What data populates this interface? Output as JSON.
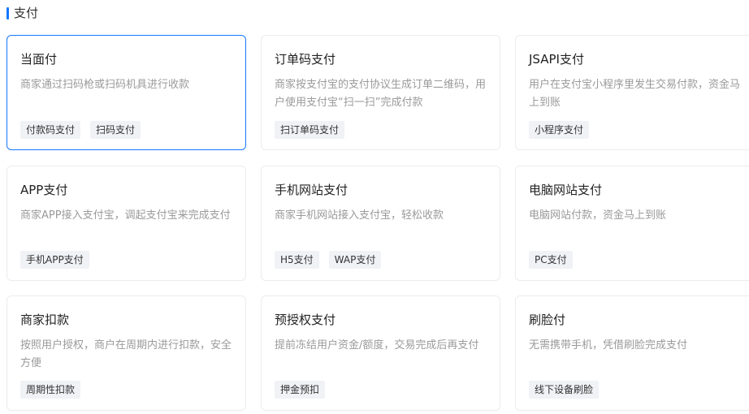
{
  "section": {
    "title": "支付"
  },
  "cards": [
    {
      "title": "当面付",
      "desc": "商家通过扫码枪或扫码机具进行收款",
      "tags": [
        "付款码支付",
        "扫码支付"
      ],
      "selected": true
    },
    {
      "title": "订单码支付",
      "desc": "商家按支付宝的支付协议生成订单二维码，用户使用支付宝“扫一扫”完成付款",
      "tags": [
        "扫订单码支付"
      ],
      "selected": false
    },
    {
      "title": "JSAPI支付",
      "desc": "用户在支付宝小程序里发生交易付款，资金马上到账",
      "tags": [
        "小程序支付"
      ],
      "selected": false
    },
    {
      "title": "APP支付",
      "desc": "商家APP接入支付宝，调起支付宝来完成支付",
      "tags": [
        "手机APP支付"
      ],
      "selected": false
    },
    {
      "title": "手机网站支付",
      "desc": "商家手机网站接入支付宝，轻松收款",
      "tags": [
        "H5支付",
        "WAP支付"
      ],
      "selected": false
    },
    {
      "title": "电脑网站支付",
      "desc": "电脑网站付款，资金马上到账",
      "tags": [
        "PC支付"
      ],
      "selected": false
    },
    {
      "title": "商家扣款",
      "desc": "按照用户授权，商户在周期内进行扣款，安全方便",
      "tags": [
        "周期性扣款"
      ],
      "selected": false
    },
    {
      "title": "预授权支付",
      "desc": "提前冻结用户资金/额度，交易完成后再支付",
      "tags": [
        "押金预扣"
      ],
      "selected": false
    },
    {
      "title": "刷脸付",
      "desc": "无需携带手机，凭借刷脸完成支付",
      "tags": [
        "线下设备刷脸"
      ],
      "selected": false
    }
  ]
}
